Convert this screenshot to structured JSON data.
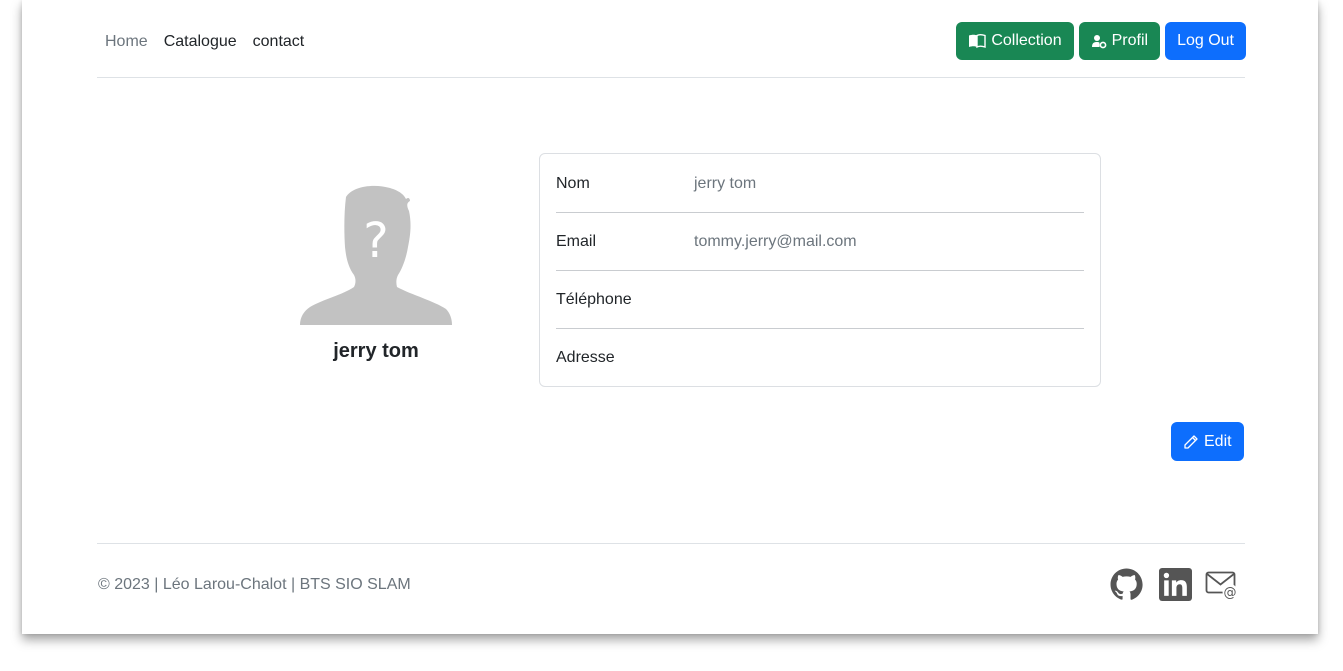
{
  "nav": {
    "links": [
      {
        "label": "Home"
      },
      {
        "label": "Catalogue"
      },
      {
        "label": "contact"
      }
    ],
    "buttons": {
      "collection": "Collection",
      "profil": "Profil",
      "logout": "Log Out"
    }
  },
  "profile": {
    "display_name": "jerry tom",
    "fields": [
      {
        "label": "Nom",
        "value": "jerry tom"
      },
      {
        "label": "Email",
        "value": "tommy.jerry@mail.com"
      },
      {
        "label": "Téléphone",
        "value": ""
      },
      {
        "label": "Adresse",
        "value": ""
      }
    ],
    "edit_label": "Edit"
  },
  "footer": {
    "text": "© 2023 | Léo Larou-Chalot | BTS SIO SLAM",
    "icons": [
      "github-icon",
      "linkedin-icon",
      "email-icon"
    ]
  },
  "colors": {
    "green": "#198754",
    "blue": "#0d6efd",
    "muted": "#6c757d",
    "avatar": "#c2c2c2"
  }
}
